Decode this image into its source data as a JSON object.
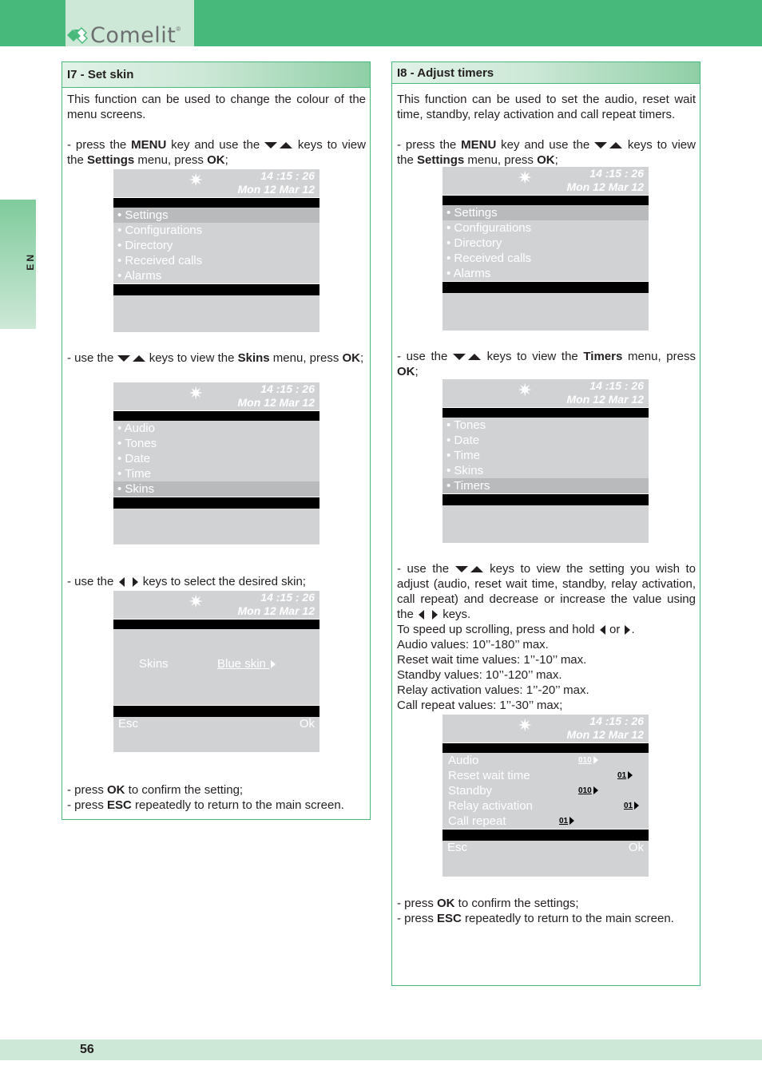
{
  "header": {
    "brand": "Comelit",
    "registered_mark": "®",
    "band_color": "#46b97b",
    "logo_bg_color": "#cde8d7"
  },
  "side_tab": {
    "label": "EN"
  },
  "footer": {
    "page_number": "56"
  },
  "screen_common": {
    "time": "14 :15 : 26",
    "date": "Mon 12 Mar 12",
    "esc": "Esc",
    "ok": "Ok",
    "icon": "sun-icon"
  },
  "left": {
    "title": "I7 - Set skin",
    "intro": "This function can be used to change the colour of the menu screens.",
    "step1": {
      "pre": "- press the ",
      "b1": "MENU",
      "mid1": " key and use the ",
      "mid2": " keys to view the ",
      "b2": "Settings",
      "mid3": " menu, press ",
      "b3": "OK",
      "end": ";"
    },
    "screen1_items": [
      "• Settings",
      "• Configurations",
      "• Directory",
      "• Received calls",
      "• Alarms"
    ],
    "step2": {
      "pre": "- use the ",
      "mid": " keys to view the ",
      "b1": "Skins",
      "mid2": " menu, press ",
      "b2": "OK",
      "end": ";"
    },
    "screen2_items": [
      "• Audio",
      "• Tones",
      "• Date",
      "• Time",
      "• Skins"
    ],
    "step3": {
      "pre": "- use the ",
      "post": " keys to select the desired skin;"
    },
    "screen3": {
      "label": "Skins",
      "value": "Blue skin "
    },
    "step4": {
      "pre": "- press ",
      "b1": "OK",
      "post": " to confirm the setting;"
    },
    "step5": {
      "pre": "- press ",
      "b1": "ESC",
      "post": " repeatedly to return to the main screen."
    }
  },
  "right": {
    "title": "I8 - Adjust timers",
    "intro": "This function can be used to set the audio, reset wait time, standby, relay activation and call repeat timers.",
    "step1": {
      "pre": "- press the ",
      "b1": "MENU",
      "mid1": " key and use the ",
      "mid2": " keys to view the ",
      "b2": "Settings",
      "mid3": " menu, press ",
      "b3": "OK",
      "end": ";"
    },
    "screen1_items": [
      "• Settings",
      "• Configurations",
      "• Directory",
      "• Received calls",
      "• Alarms"
    ],
    "step2": {
      "pre": "- use the ",
      "mid": " keys to view the ",
      "b1": "Timers",
      "mid2": " menu, press ",
      "b2": "OK",
      "end": ";"
    },
    "screen2_items": [
      "• Tones",
      "• Date",
      "• Time",
      "• Skins",
      "• Timers"
    ],
    "step3": {
      "pre": "- use the ",
      "mid": " keys to view the setting you wish to adjust (audio, reset wait time, standby, relay activation, call repeat) and decrease or increase the value using the ",
      "post": " keys."
    },
    "speed": {
      "pre": "To speed up scrolling, press and hold ",
      "or": " or ",
      "end": "."
    },
    "values": [
      "Audio values: 10’’-180’’ max.",
      "Reset wait time values: 1’’-10’’ max.",
      "Standby values: 10’’-120’’ max.",
      "Relay activation values: 1’’-20’’ max.",
      "Call repeat values: 1’’-30’’ max;"
    ],
    "timers": [
      {
        "label": "Audio",
        "value": "010"
      },
      {
        "label": "Reset wait time",
        "value": "01"
      },
      {
        "label": "Standby",
        "value": "010"
      },
      {
        "label": "Relay activation",
        "value": "01"
      },
      {
        "label": "Call repeat",
        "value": "01"
      }
    ],
    "step4": {
      "pre": "- press ",
      "b1": "OK",
      "post": " to confirm the settings;"
    },
    "step5": {
      "pre": "- press ",
      "b1": "ESC",
      "post": " repeatedly to return to the main screen."
    }
  }
}
